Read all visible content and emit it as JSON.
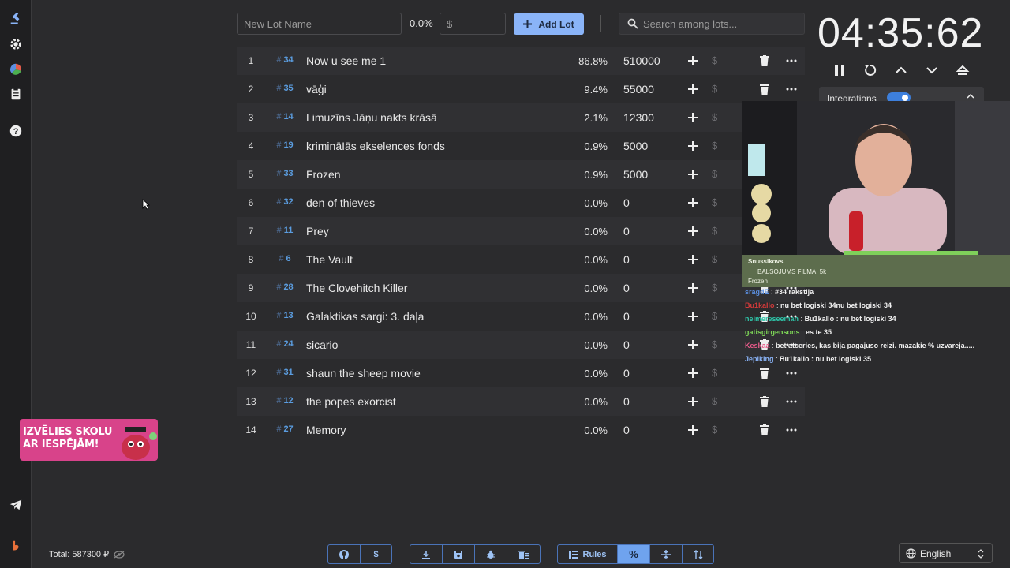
{
  "rail": {
    "icons": [
      "gavel-icon",
      "gear-icon",
      "pie-chart-icon",
      "clipboard-icon",
      "help-icon",
      "telegram-icon",
      "brand-icon"
    ]
  },
  "toolbar": {
    "new_lot_placeholder": "New Lot Name",
    "percent": "0.0%",
    "amount_placeholder": "$",
    "add_lot_label": "Add Lot",
    "search_placeholder": "Search among lots..."
  },
  "lots": [
    {
      "num": "1",
      "id": "34",
      "name": "Now u see me 1",
      "pct": "86.8%",
      "amount": "510000"
    },
    {
      "num": "2",
      "id": "35",
      "name": "vāģi",
      "pct": "9.4%",
      "amount": "55000"
    },
    {
      "num": "3",
      "id": "14",
      "name": "Limuzīns Jāņu nakts krāsā",
      "pct": "2.1%",
      "amount": "12300"
    },
    {
      "num": "4",
      "id": "19",
      "name": "krimināIās ekselences fonds",
      "pct": "0.9%",
      "amount": "5000"
    },
    {
      "num": "5",
      "id": "33",
      "name": "Frozen",
      "pct": "0.9%",
      "amount": "5000"
    },
    {
      "num": "6",
      "id": "32",
      "name": "den of thieves",
      "pct": "0.0%",
      "amount": "0"
    },
    {
      "num": "7",
      "id": "11",
      "name": "Prey",
      "pct": "0.0%",
      "amount": "0"
    },
    {
      "num": "8",
      "id": "6",
      "name": "The Vault",
      "pct": "0.0%",
      "amount": "0"
    },
    {
      "num": "9",
      "id": "28",
      "name": "The Clovehitch Killer",
      "pct": "0.0%",
      "amount": "0"
    },
    {
      "num": "10",
      "id": "13",
      "name": "Galaktikas sargi: 3. daļa",
      "pct": "0.0%",
      "amount": "0"
    },
    {
      "num": "11",
      "id": "24",
      "name": "sicario",
      "pct": "0.0%",
      "amount": "0"
    },
    {
      "num": "12",
      "id": "31",
      "name": "shaun the sheep movie",
      "pct": "0.0%",
      "amount": "0"
    },
    {
      "num": "13",
      "id": "12",
      "name": "the popes exorcist",
      "pct": "0.0%",
      "amount": "0"
    },
    {
      "num": "14",
      "id": "27",
      "name": "Memory",
      "pct": "0.0%",
      "amount": "0"
    }
  ],
  "timer": {
    "display": "04:35:62"
  },
  "integrations": {
    "label": "Integrations",
    "enabled": true
  },
  "chat": {
    "banner_user": "Snussikovs",
    "banner_title": "BALSOJUMS FILMAI 5k",
    "banner_sub": "Frozen",
    "lines": [
      {
        "user": "sragdE",
        "color": "#5b8fe0",
        "text": "#34 rakstija"
      },
      {
        "user": "Bu1kallo",
        "color": "#d23a3a",
        "text": "nu bet logiski 34nu bet logiski 34"
      },
      {
        "user": "neimereseeman",
        "color": "#2ec4a8",
        "text": "Bu1kallo : nu bet logiski 34"
      },
      {
        "user": "gatisgirgensons",
        "color": "#7ed957",
        "text": "es te 35"
      },
      {
        "user": "Keskaa",
        "color": "#e85b8a",
        "text": "bet atceries, kas bija pagajuso reizi. mazakie % uzvareja....."
      },
      {
        "user": "Jepiking",
        "color": "#8ab4f8",
        "text": "Bu1kallo : nu bet logiski 35"
      }
    ]
  },
  "promo": {
    "line1": "IZVĒLIES SKOLU",
    "line2": "AR IESPĒJĀM!"
  },
  "footer": {
    "total_label": "Total: 587300 ₽",
    "rules_label": "Rules",
    "language": "English"
  },
  "colors": {
    "accent": "#8ab4f8",
    "id_blue": "#5b9de0",
    "background": "#2b2b2d"
  }
}
